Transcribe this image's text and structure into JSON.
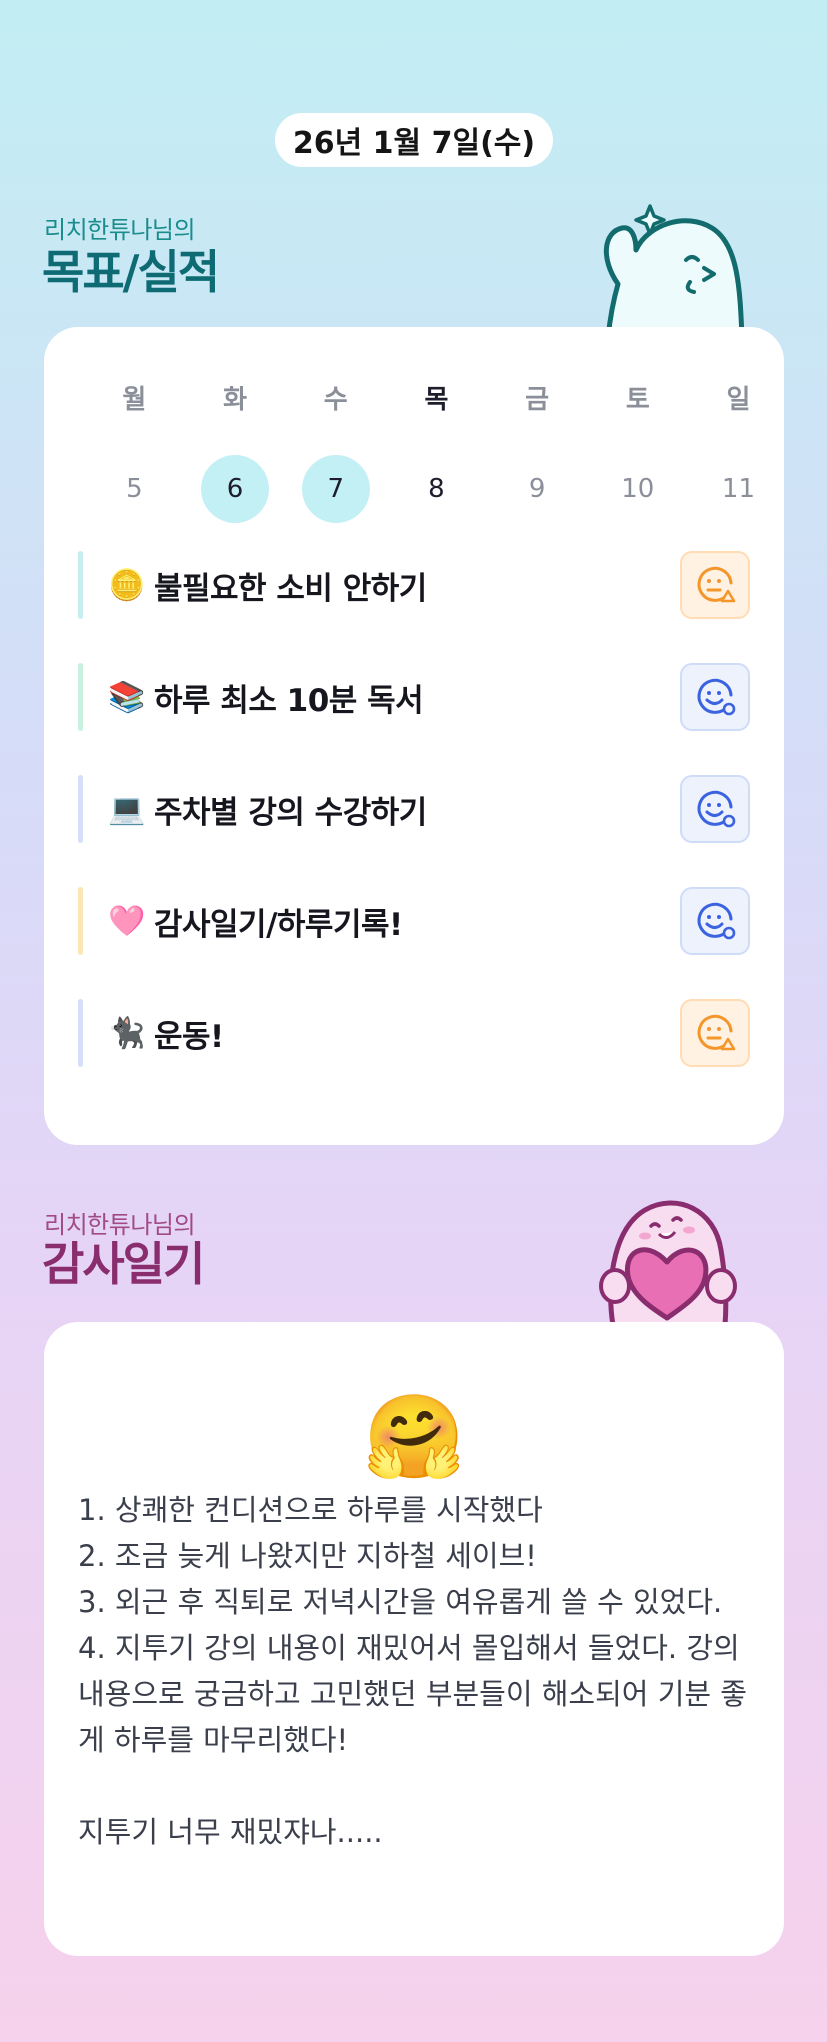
{
  "header": {
    "date": "26년 1월 7일(수)"
  },
  "goals_section": {
    "subtitle": "리치한튜나님의",
    "title": "목표/실적"
  },
  "week": {
    "day_names": [
      "월",
      "화",
      "수",
      "목",
      "금",
      "토",
      "일"
    ],
    "day_numbers": [
      "5",
      "6",
      "7",
      "8",
      "9",
      "10",
      "11"
    ],
    "completed_days": [
      "6",
      "7"
    ],
    "today": "8"
  },
  "goals": [
    {
      "emoji": "🪙",
      "label": "불필요한 소비 안하기",
      "bar_color": "#c6eef1",
      "status": "warning",
      "status_icon": "face-warning-icon"
    },
    {
      "emoji": "📚",
      "label": "하루 최소 10분 독서",
      "bar_color": "#c9f1df",
      "status": "good",
      "status_icon": "face-good-icon"
    },
    {
      "emoji": "💻",
      "label": "주차별 강의 수강하기",
      "bar_color": "#d6dff8",
      "status": "good",
      "status_icon": "face-good-icon"
    },
    {
      "emoji": "🩷",
      "label": "감사일기/하루기록!",
      "bar_color": "#fbe6b8",
      "status": "good",
      "status_icon": "face-good-icon"
    },
    {
      "emoji": "🐈‍⬛",
      "label": "운동!",
      "bar_color": "#d6dff8",
      "status": "warning",
      "status_icon": "face-warning-icon"
    }
  ],
  "diary_section": {
    "subtitle": "리치한튜나님의",
    "title": "감사일기"
  },
  "diary": {
    "emoji": "🤗",
    "text": "1. 상쾌한 컨디션으로 하루를 시작했다\n2. 조금 늦게 나왔지만 지하철 세이브!\n3. 외근 후 직퇴로 저녁시간을 여유롭게 쓸 수 있었다.\n4. 지투기 강의 내용이 재밌어서 몰입해서 들었다. 강의 내용으로 궁금하고 고민했던 부분들이 해소되어 기분 좋게 하루를 마무리했다!\n\n지투기 너무 재밌쟈나....."
  },
  "colors": {
    "accent_teal": "#0e6b73",
    "accent_plum": "#8a2d6e",
    "done_circle": "#c3f0f4",
    "warning": "#f5962b",
    "good": "#3b63e0"
  }
}
